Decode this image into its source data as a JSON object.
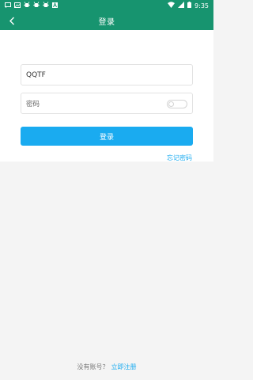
{
  "status_bar": {
    "time": "9:35",
    "left_icons": [
      "message-icon",
      "photo-icon",
      "debug-icon",
      "debug-icon",
      "debug-icon",
      "a-icon"
    ],
    "right_icons": [
      "wifi-icon",
      "signal-icon",
      "battery-icon"
    ]
  },
  "header": {
    "title": "登录"
  },
  "form": {
    "username_value": "QQTF",
    "password_placeholder": "密码",
    "login_button": "登录",
    "forgot_link": "忘记密码"
  },
  "footer": {
    "prompt": "没有账号？",
    "register_link": "立即注册"
  },
  "colors": {
    "header": "#17946f",
    "accent": "#1aabf0",
    "background": "#f4f4f4"
  }
}
